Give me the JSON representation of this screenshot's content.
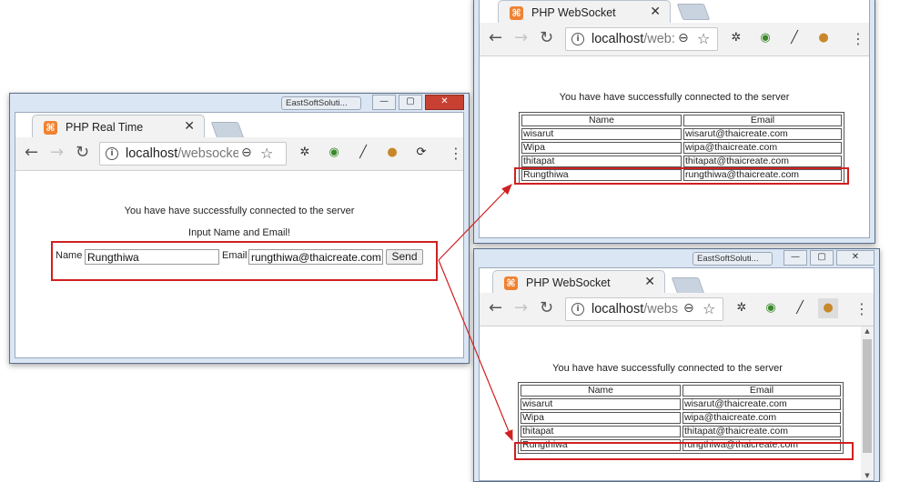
{
  "colors": {
    "favicon": "#f08232",
    "highlight": "#d02020",
    "arrow": "#d02020",
    "close_button": "#c84031"
  },
  "left_window": {
    "badge": "EastSoftSoluti...",
    "tab_title": "PHP Real Time",
    "url_host": "localhost",
    "url_path": "/websocke",
    "status": "You have have successfully connected to the server",
    "prompt": "Input Name and Email!",
    "name_label": "Name",
    "name_value": "Rungthiwa",
    "email_label": "Email",
    "email_value": "rungthiwa@thaicreate.com",
    "send_label": "Send"
  },
  "top_right_window": {
    "tab_title": "PHP WebSocket",
    "url_host": "localhost",
    "url_path": "/web:",
    "status": "You have have successfully connected to the server",
    "table": {
      "headers": [
        "Name",
        "Email"
      ],
      "rows": [
        [
          "wisarut",
          "wisarut@thaicreate.com"
        ],
        [
          "Wipa",
          "wipa@thaicreate.com"
        ],
        [
          "thitapat",
          "thitapat@thaicreate.com"
        ],
        [
          "Rungthiwa",
          "rungthiwa@thaicreate.com"
        ]
      ]
    }
  },
  "bottom_right_window": {
    "badge": "EastSoftSoluti...",
    "tab_title": "PHP WebSocket",
    "url_host": "localhost",
    "url_path": "/webs",
    "status": "You have have successfully connected to the server",
    "table": {
      "headers": [
        "Name",
        "Email"
      ],
      "rows": [
        [
          "wisarut",
          "wisarut@thaicreate.com"
        ],
        [
          "Wipa",
          "wipa@thaicreate.com"
        ],
        [
          "thitapat",
          "thitapat@thaicreate.com"
        ],
        [
          "Rungthiwa",
          "rungthiwa@thaicreate.com"
        ]
      ]
    }
  },
  "icons": {
    "favicon": "xampp-icon",
    "back": "back-arrow-icon",
    "forward": "forward-arrow-icon",
    "reload": "reload-icon",
    "info": "info-icon",
    "zoom": "zoom-icon",
    "star": "bookmark-star-icon",
    "menu": "kebab-menu-icon",
    "close": "close-icon"
  }
}
